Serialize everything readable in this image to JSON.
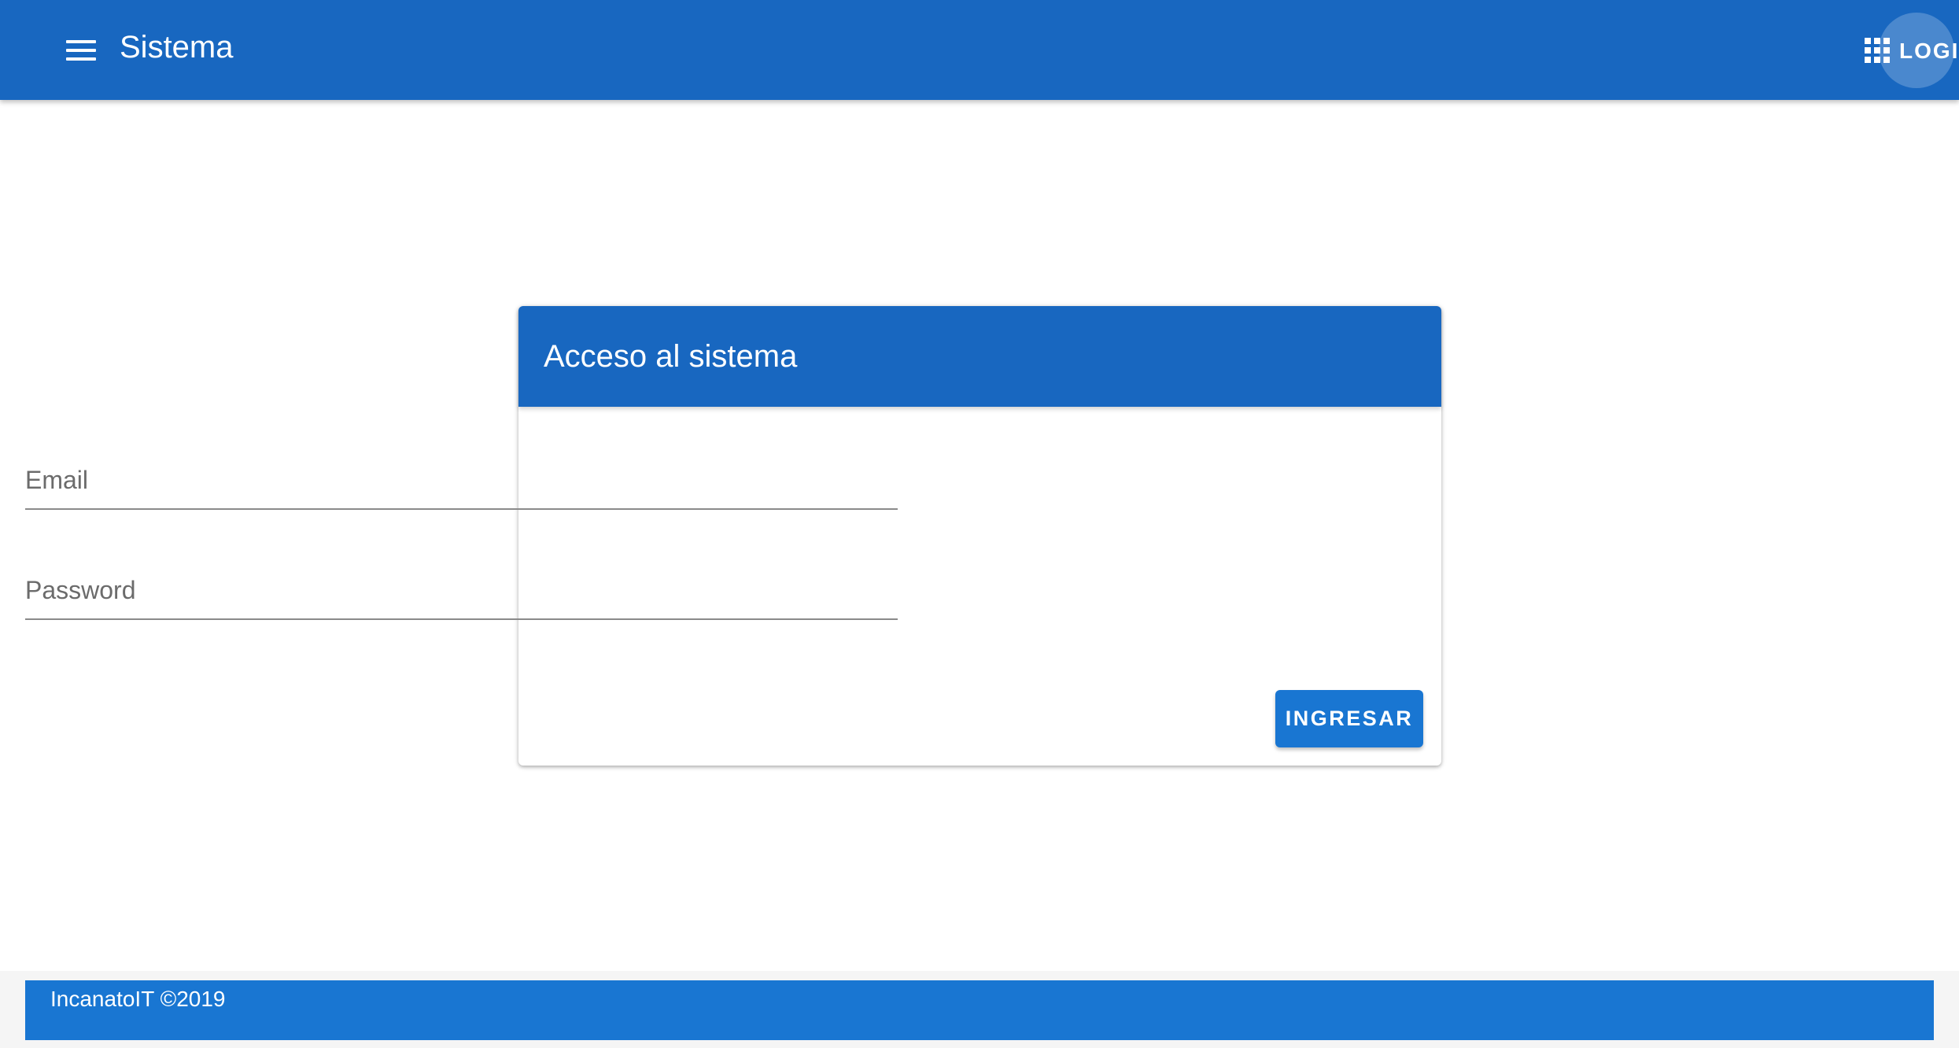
{
  "app_bar": {
    "title": "Sistema",
    "menu_icon": "hamburger-menu-icon",
    "login_icon": "apps-grid-icon",
    "login_label": "LOGI",
    "color": "#1867c0"
  },
  "login_card": {
    "title": "Acceso al sistema",
    "email_label": "Email",
    "password_label": "Password",
    "submit_label": "INGRESAR",
    "header_color": "#1867c0",
    "button_color": "#1976d2"
  },
  "footer": {
    "text": "IncanatoIT ©2019",
    "color": "#1976d2"
  }
}
